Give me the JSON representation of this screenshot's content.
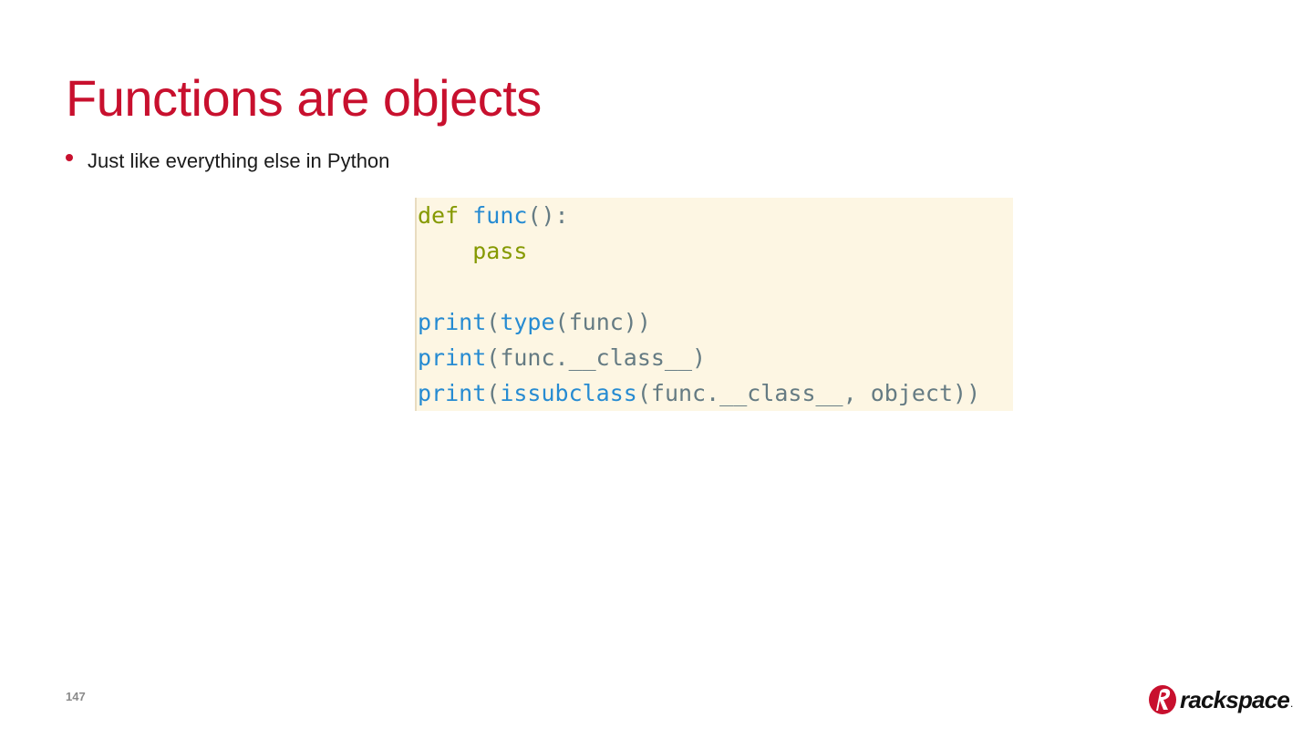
{
  "slide": {
    "title": "Functions are objects",
    "bullets": [
      {
        "text": "Just like everything else in Python"
      }
    ],
    "page_number": "147"
  },
  "code": {
    "language": "python",
    "lines": [
      [
        {
          "t": "def",
          "k": "kw"
        },
        {
          "t": " ",
          "k": "plain"
        },
        {
          "t": "func",
          "k": "fn"
        },
        {
          "t": "():",
          "k": "plain"
        }
      ],
      [
        {
          "t": "    ",
          "k": "plain"
        },
        {
          "t": "pass",
          "k": "kw"
        }
      ],
      [],
      [
        {
          "t": "print",
          "k": "fn"
        },
        {
          "t": "(",
          "k": "plain"
        },
        {
          "t": "type",
          "k": "fn"
        },
        {
          "t": "(func))",
          "k": "plain"
        }
      ],
      [
        {
          "t": "print",
          "k": "fn"
        },
        {
          "t": "(func.__class__)",
          "k": "plain"
        }
      ],
      [
        {
          "t": "print",
          "k": "fn"
        },
        {
          "t": "(",
          "k": "plain"
        },
        {
          "t": "issubclass",
          "k": "fn"
        },
        {
          "t": "(func.__class__, object))",
          "k": "plain"
        }
      ]
    ]
  },
  "logo": {
    "text": "rackspace",
    "icon": "rackspace-logo-icon"
  },
  "colors": {
    "accent": "#c8102e",
    "code_background": "#fdf6e3",
    "keyword": "#859900",
    "function": "#268bd2",
    "plain": "#657b83"
  }
}
